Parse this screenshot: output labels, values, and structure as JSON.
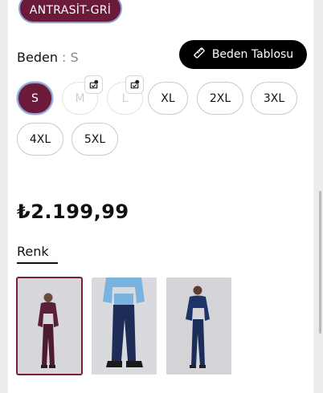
{
  "selected_color": {
    "label": "ANTRASİT-GRİ"
  },
  "size": {
    "label": "Beden",
    "separator": " : ",
    "selected": "S",
    "table_button": "Beden Tablosu",
    "options": [
      {
        "label": "S",
        "state": "selected"
      },
      {
        "label": "M",
        "state": "out-of-stock"
      },
      {
        "label": "L",
        "state": "out-of-stock"
      },
      {
        "label": "XL",
        "state": "available"
      },
      {
        "label": "2XL",
        "state": "available"
      },
      {
        "label": "3XL",
        "state": "available"
      },
      {
        "label": "4XL",
        "state": "available"
      },
      {
        "label": "5XL",
        "state": "available"
      }
    ]
  },
  "price": "₺2.199,99",
  "color_section": {
    "title": "Renk",
    "variants": [
      {
        "name": "maroon-tracksuit",
        "selected": true,
        "color": "#5a1f36"
      },
      {
        "name": "sky-blue-top-navy-pants",
        "selected": false,
        "color": "#1d2f5c"
      },
      {
        "name": "navy-tracksuit",
        "selected": false,
        "color": "#1f3466"
      }
    ]
  },
  "colors": {
    "brand": "#6b1a3a",
    "selection_ring": "#8aa5d6",
    "button_dark": "#000000"
  }
}
